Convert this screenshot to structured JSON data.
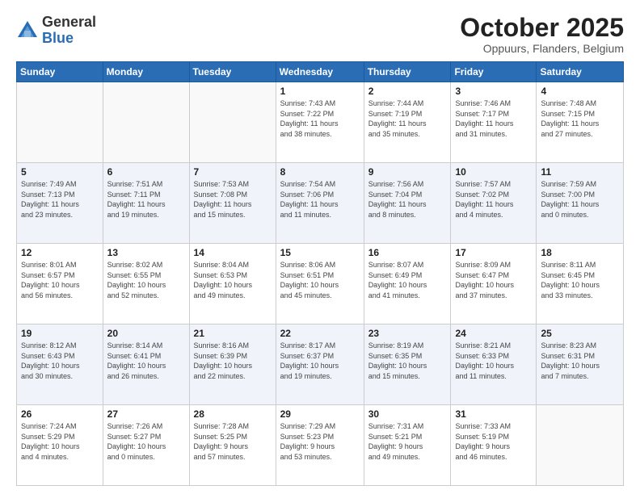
{
  "header": {
    "logo_general": "General",
    "logo_blue": "Blue",
    "month_title": "October 2025",
    "location": "Oppuurs, Flanders, Belgium"
  },
  "weekdays": [
    "Sunday",
    "Monday",
    "Tuesday",
    "Wednesday",
    "Thursday",
    "Friday",
    "Saturday"
  ],
  "weeks": [
    [
      {
        "day": "",
        "info": ""
      },
      {
        "day": "",
        "info": ""
      },
      {
        "day": "",
        "info": ""
      },
      {
        "day": "1",
        "info": "Sunrise: 7:43 AM\nSunset: 7:22 PM\nDaylight: 11 hours\nand 38 minutes."
      },
      {
        "day": "2",
        "info": "Sunrise: 7:44 AM\nSunset: 7:19 PM\nDaylight: 11 hours\nand 35 minutes."
      },
      {
        "day": "3",
        "info": "Sunrise: 7:46 AM\nSunset: 7:17 PM\nDaylight: 11 hours\nand 31 minutes."
      },
      {
        "day": "4",
        "info": "Sunrise: 7:48 AM\nSunset: 7:15 PM\nDaylight: 11 hours\nand 27 minutes."
      }
    ],
    [
      {
        "day": "5",
        "info": "Sunrise: 7:49 AM\nSunset: 7:13 PM\nDaylight: 11 hours\nand 23 minutes."
      },
      {
        "day": "6",
        "info": "Sunrise: 7:51 AM\nSunset: 7:11 PM\nDaylight: 11 hours\nand 19 minutes."
      },
      {
        "day": "7",
        "info": "Sunrise: 7:53 AM\nSunset: 7:08 PM\nDaylight: 11 hours\nand 15 minutes."
      },
      {
        "day": "8",
        "info": "Sunrise: 7:54 AM\nSunset: 7:06 PM\nDaylight: 11 hours\nand 11 minutes."
      },
      {
        "day": "9",
        "info": "Sunrise: 7:56 AM\nSunset: 7:04 PM\nDaylight: 11 hours\nand 8 minutes."
      },
      {
        "day": "10",
        "info": "Sunrise: 7:57 AM\nSunset: 7:02 PM\nDaylight: 11 hours\nand 4 minutes."
      },
      {
        "day": "11",
        "info": "Sunrise: 7:59 AM\nSunset: 7:00 PM\nDaylight: 11 hours\nand 0 minutes."
      }
    ],
    [
      {
        "day": "12",
        "info": "Sunrise: 8:01 AM\nSunset: 6:57 PM\nDaylight: 10 hours\nand 56 minutes."
      },
      {
        "day": "13",
        "info": "Sunrise: 8:02 AM\nSunset: 6:55 PM\nDaylight: 10 hours\nand 52 minutes."
      },
      {
        "day": "14",
        "info": "Sunrise: 8:04 AM\nSunset: 6:53 PM\nDaylight: 10 hours\nand 49 minutes."
      },
      {
        "day": "15",
        "info": "Sunrise: 8:06 AM\nSunset: 6:51 PM\nDaylight: 10 hours\nand 45 minutes."
      },
      {
        "day": "16",
        "info": "Sunrise: 8:07 AM\nSunset: 6:49 PM\nDaylight: 10 hours\nand 41 minutes."
      },
      {
        "day": "17",
        "info": "Sunrise: 8:09 AM\nSunset: 6:47 PM\nDaylight: 10 hours\nand 37 minutes."
      },
      {
        "day": "18",
        "info": "Sunrise: 8:11 AM\nSunset: 6:45 PM\nDaylight: 10 hours\nand 33 minutes."
      }
    ],
    [
      {
        "day": "19",
        "info": "Sunrise: 8:12 AM\nSunset: 6:43 PM\nDaylight: 10 hours\nand 30 minutes."
      },
      {
        "day": "20",
        "info": "Sunrise: 8:14 AM\nSunset: 6:41 PM\nDaylight: 10 hours\nand 26 minutes."
      },
      {
        "day": "21",
        "info": "Sunrise: 8:16 AM\nSunset: 6:39 PM\nDaylight: 10 hours\nand 22 minutes."
      },
      {
        "day": "22",
        "info": "Sunrise: 8:17 AM\nSunset: 6:37 PM\nDaylight: 10 hours\nand 19 minutes."
      },
      {
        "day": "23",
        "info": "Sunrise: 8:19 AM\nSunset: 6:35 PM\nDaylight: 10 hours\nand 15 minutes."
      },
      {
        "day": "24",
        "info": "Sunrise: 8:21 AM\nSunset: 6:33 PM\nDaylight: 10 hours\nand 11 minutes."
      },
      {
        "day": "25",
        "info": "Sunrise: 8:23 AM\nSunset: 6:31 PM\nDaylight: 10 hours\nand 7 minutes."
      }
    ],
    [
      {
        "day": "26",
        "info": "Sunrise: 7:24 AM\nSunset: 5:29 PM\nDaylight: 10 hours\nand 4 minutes."
      },
      {
        "day": "27",
        "info": "Sunrise: 7:26 AM\nSunset: 5:27 PM\nDaylight: 10 hours\nand 0 minutes."
      },
      {
        "day": "28",
        "info": "Sunrise: 7:28 AM\nSunset: 5:25 PM\nDaylight: 9 hours\nand 57 minutes."
      },
      {
        "day": "29",
        "info": "Sunrise: 7:29 AM\nSunset: 5:23 PM\nDaylight: 9 hours\nand 53 minutes."
      },
      {
        "day": "30",
        "info": "Sunrise: 7:31 AM\nSunset: 5:21 PM\nDaylight: 9 hours\nand 49 minutes."
      },
      {
        "day": "31",
        "info": "Sunrise: 7:33 AM\nSunset: 5:19 PM\nDaylight: 9 hours\nand 46 minutes."
      },
      {
        "day": "",
        "info": ""
      }
    ]
  ]
}
